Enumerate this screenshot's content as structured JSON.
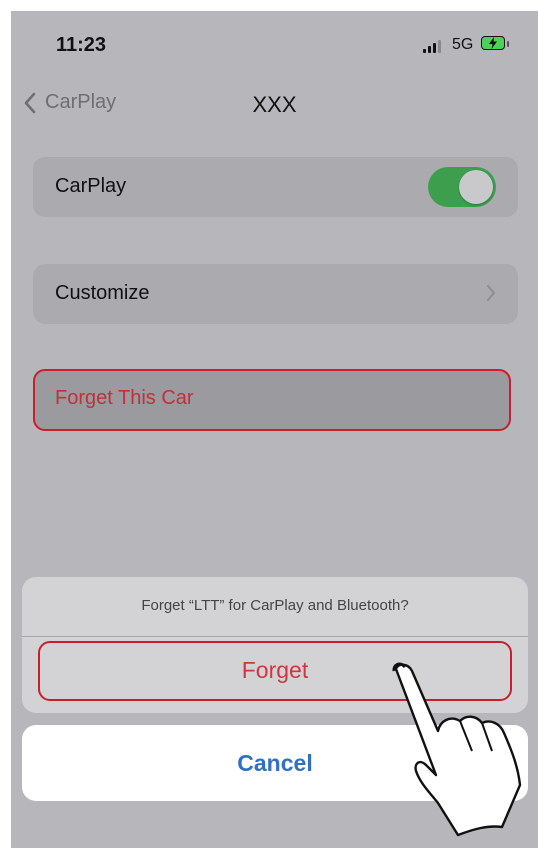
{
  "status_bar": {
    "time": "11:23",
    "network": "5G"
  },
  "nav": {
    "back_label": "CarPlay",
    "title": "XXX"
  },
  "settings": {
    "carplay_label": "CarPlay",
    "carplay_enabled": true,
    "customize_label": "Customize",
    "forget_car_label": "Forget This Car"
  },
  "action_sheet": {
    "message": "Forget “LTT” for CarPlay and Bluetooth?",
    "forget_label": "Forget",
    "cancel_label": "Cancel"
  },
  "colors": {
    "destructive": "#d0363f",
    "highlight_outline": "#c81f2c",
    "toggle_on": "#3d9e4e",
    "cancel_text": "#2f6fc4"
  },
  "icons": [
    "cellular-signal-icon",
    "battery-charging-icon",
    "chevron-left-icon",
    "chevron-right-icon",
    "tapping-hand-icon"
  ]
}
